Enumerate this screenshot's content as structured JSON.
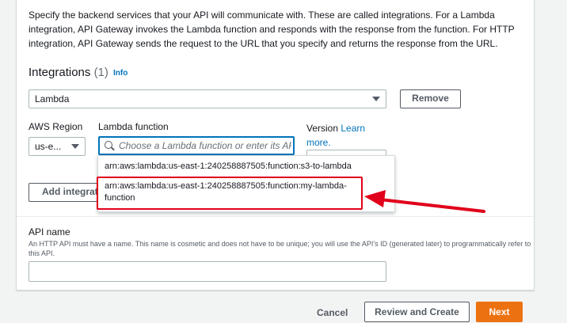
{
  "description": "Specify the backend services that your API will communicate with. These are called integrations. For a Lambda integration, API Gateway invokes the Lambda function and responds with the response from the function. For HTTP integration, API Gateway sends the request to the URL that you specify and returns the response from the URL.",
  "integrations": {
    "title": "Integrations",
    "count": "(1)",
    "info_label": "Info",
    "type_value": "Lambda",
    "remove_label": "Remove",
    "region_label": "AWS Region",
    "region_value": "us-e...",
    "function_label": "Lambda function",
    "function_placeholder": "Choose a Lambda function or enter its ARN",
    "version_label": "Version",
    "learn_more_label": "Learn more.",
    "add_integration_label": "Add integrat",
    "options": [
      "arn:aws:lambda:us-east-1:240258887505:function:s3-to-lambda",
      "arn:aws:lambda:us-east-1:240258887505:function:my-lambda-function"
    ]
  },
  "api_name": {
    "label": "API name",
    "help": "An HTTP API must have a name. This name is cosmetic and does not have to be unique; you will use the API's ID (generated later) to programmatically refer to this API.",
    "value": ""
  },
  "footer": {
    "cancel_label": "Cancel",
    "review_label": "Review and Create",
    "next_label": "Next"
  },
  "colors": {
    "accent": "#0073bb",
    "primary": "#ec7211",
    "annotation": "#e0001b"
  }
}
